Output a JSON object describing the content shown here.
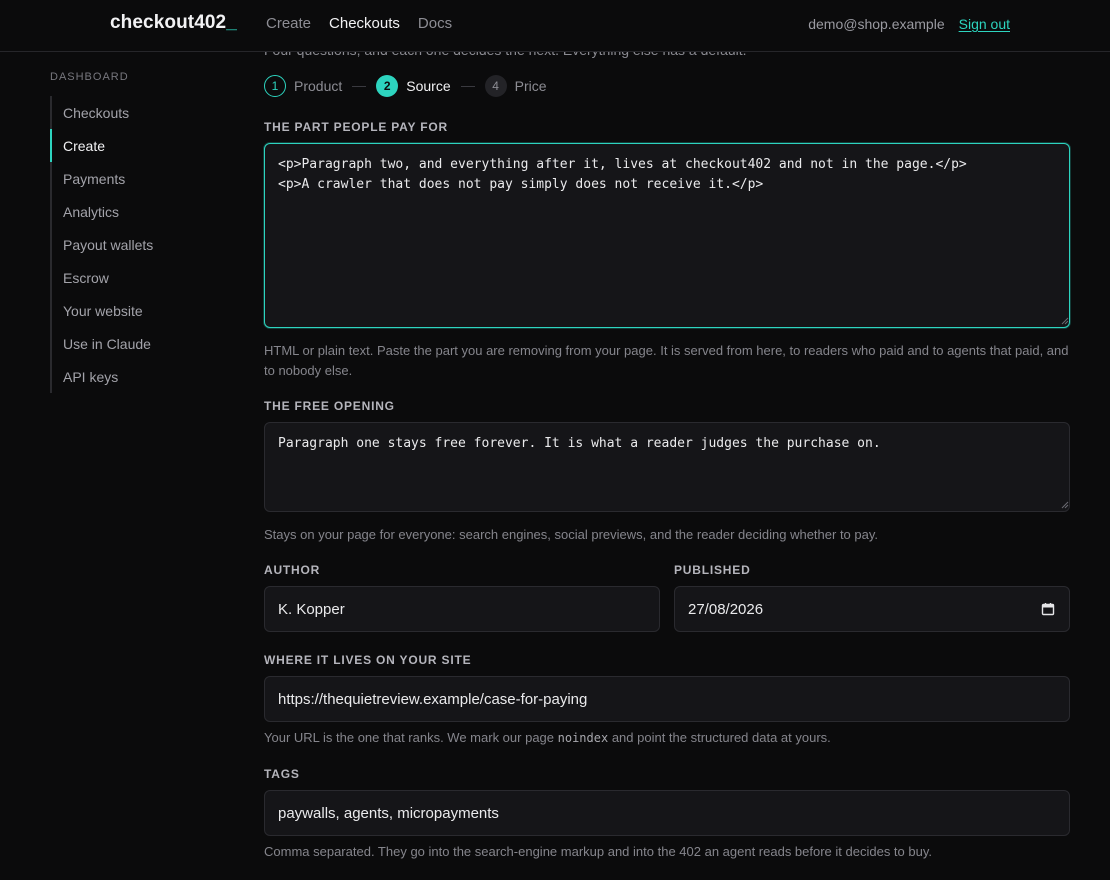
{
  "app": {
    "brand": "checkout402",
    "brand_cursor": "_",
    "accent": "#2dd4bf"
  },
  "topnav": {
    "items": [
      {
        "label": "Create",
        "active": false
      },
      {
        "label": "Checkouts",
        "active": true
      },
      {
        "label": "Docs",
        "active": false
      }
    ]
  },
  "account": {
    "email": "demo@shop.example",
    "signout": "Sign out"
  },
  "sidebar": {
    "heading": "DASHBOARD",
    "items": [
      {
        "label": "Checkouts",
        "active": false
      },
      {
        "label": "Create",
        "active": true
      },
      {
        "label": "Payments",
        "active": false
      },
      {
        "label": "Analytics",
        "active": false
      },
      {
        "label": "Payout wallets",
        "active": false
      },
      {
        "label": "Escrow",
        "active": false
      },
      {
        "label": "Your website",
        "active": false
      },
      {
        "label": "Use in Claude",
        "active": false
      },
      {
        "label": "API keys",
        "active": false
      }
    ]
  },
  "intro": {
    "text_cut": "Four questions, and each one decides the next. Everything else has a default."
  },
  "steps": [
    {
      "num": "1",
      "label": "Product",
      "state": "done"
    },
    {
      "num": "2",
      "label": "Source",
      "state": "current"
    },
    {
      "num": "4",
      "label": "Price",
      "state": "upcoming"
    }
  ],
  "form": {
    "paid_part": {
      "label": "THE PART PEOPLE PAY FOR",
      "value": "<p>Paragraph two, and everything after it, lives at checkout402 and not in the page.</p>\n<p>A crawler that does not pay simply does not receive it.</p>",
      "hint": "HTML or plain text. Paste the part you are removing from your page. It is served from here, to readers who paid and to agents that paid, and to nobody else."
    },
    "free_opening": {
      "label": "THE FREE OPENING",
      "value": "Paragraph one stays free forever. It is what a reader judges the purchase on.",
      "hint": "Stays on your page for everyone: search engines, social previews, and the reader deciding whether to pay."
    },
    "author": {
      "label": "AUTHOR",
      "value": "K. Kopper"
    },
    "published": {
      "label": "PUBLISHED",
      "value": "27/08/2026"
    },
    "location": {
      "label": "WHERE IT LIVES ON YOUR SITE",
      "value": "https://thequietreview.example/case-for-paying",
      "hint_before": "Your URL is the one that ranks. We mark our page ",
      "hint_code": "noindex",
      "hint_after": " and point the structured data at yours."
    },
    "tags": {
      "label": "TAGS",
      "value": "paywalls, agents, micropayments",
      "hint": "Comma separated. They go into the search-engine markup and into the 402 an agent reads before it decides to buy."
    }
  }
}
